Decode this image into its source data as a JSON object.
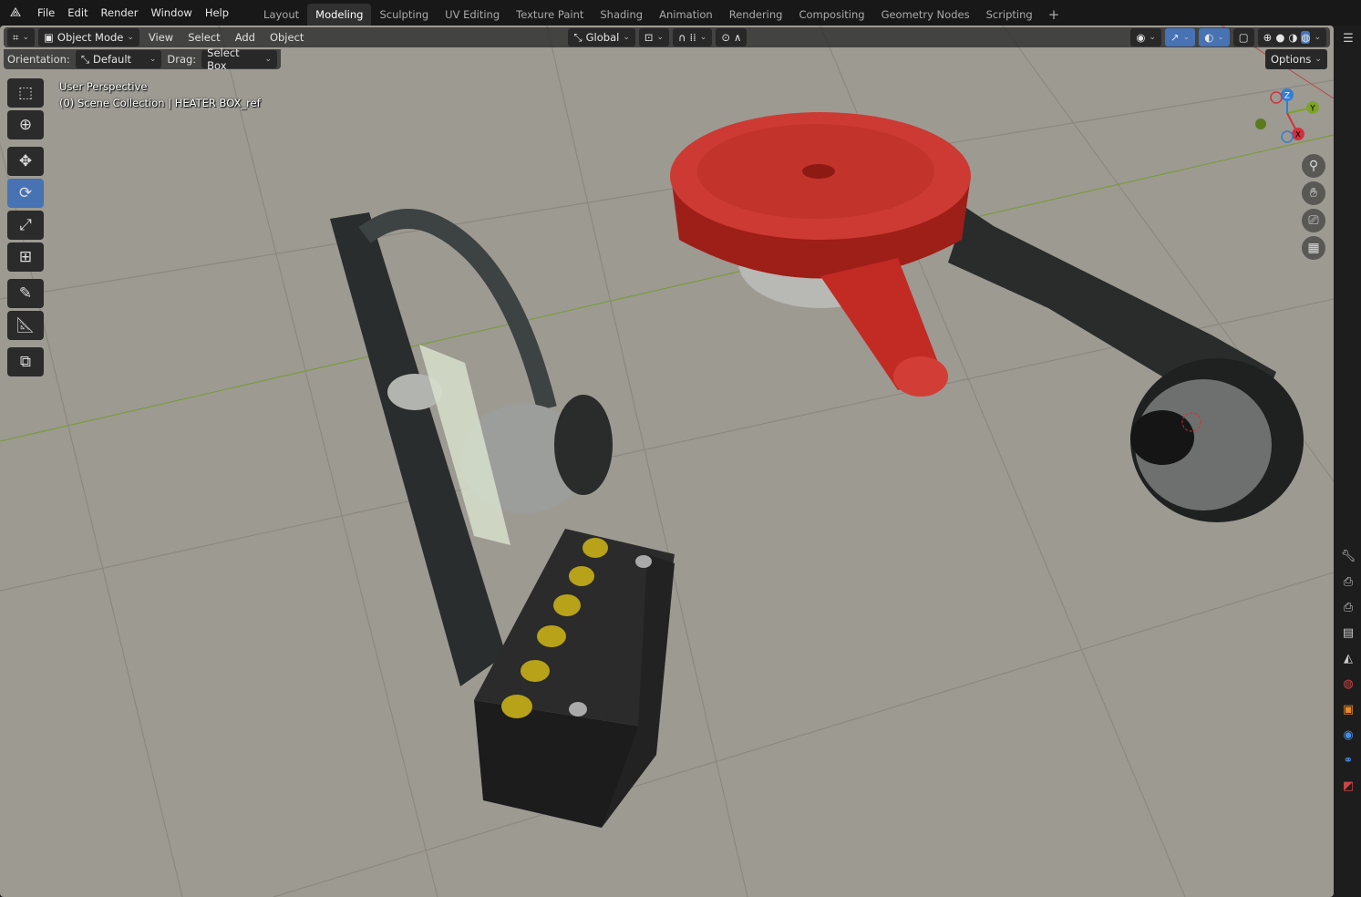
{
  "app": {
    "menu": [
      "File",
      "Edit",
      "Render",
      "Window",
      "Help"
    ],
    "workspaces": [
      "Layout",
      "Modeling",
      "Sculpting",
      "UV Editing",
      "Texture Paint",
      "Shading",
      "Animation",
      "Rendering",
      "Compositing",
      "Geometry Nodes",
      "Scripting"
    ],
    "active_workspace": "Modeling"
  },
  "header": {
    "mode": "Object Mode",
    "menus": [
      "View",
      "Select",
      "Add",
      "Object"
    ],
    "orientation": "Global"
  },
  "toolsettings": {
    "orientation_label": "Orientation:",
    "orientation_value": "Default",
    "drag_label": "Drag:",
    "drag_value": "Select Box",
    "options": "Options"
  },
  "viewport": {
    "view_name": "User Perspective",
    "collection": "(0) Scene Collection | HEATER BOX_ref"
  },
  "gizmo": {
    "x": "X",
    "y": "Y",
    "z": "Z"
  },
  "colors": {
    "accent": "#4772b3",
    "floor": "#9d9a92",
    "red_part": "#c8302a"
  }
}
